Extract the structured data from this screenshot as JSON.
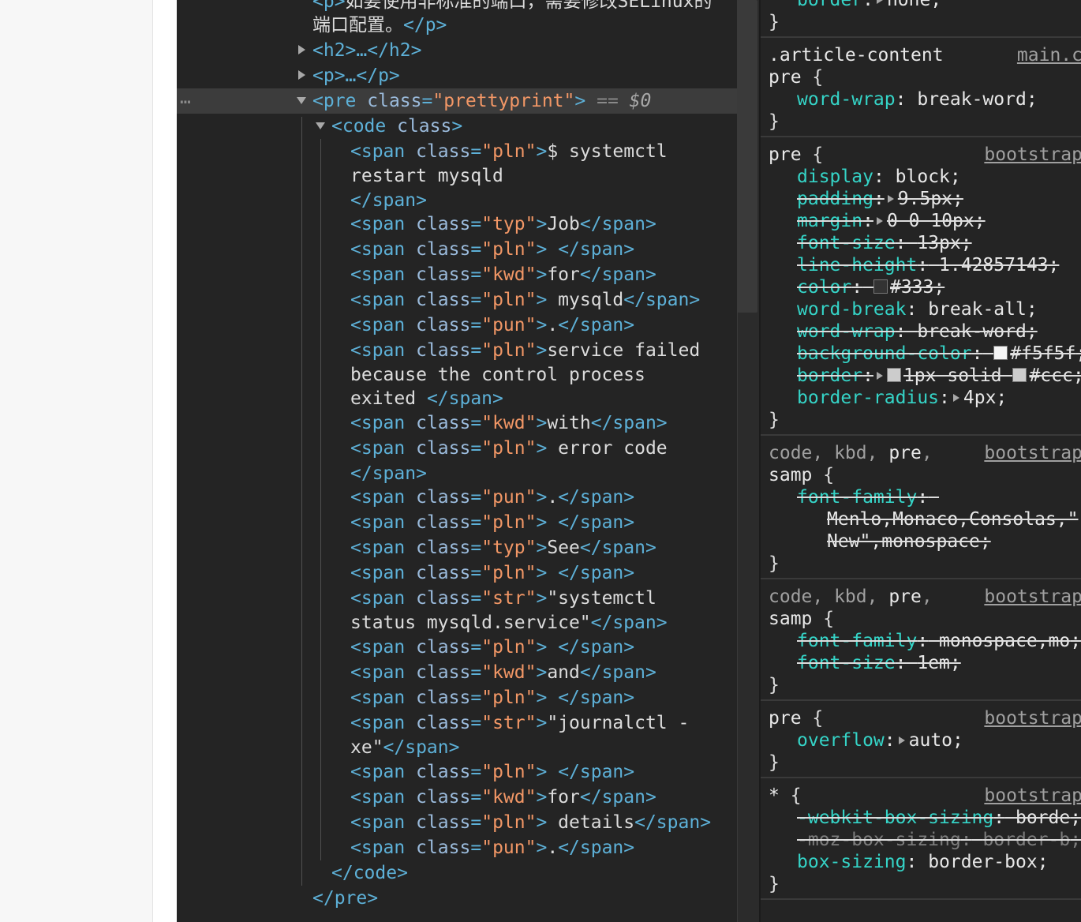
{
  "elements": {
    "p_text_1": "如要使用非标准的端口，需要修改SELinux的",
    "p_text_2": "端口配置。",
    "h2_collapsed": "<h2>…</h2>",
    "p_collapsed": "<p>…</p>",
    "pre_open": "<pre",
    "pre_attr": "class",
    "pre_value": "\"prettyprint\"",
    "pre_close": ">",
    "eq_marker": "== ",
    "dollar_zero": "$0",
    "ellipsis": "…",
    "code_open": "<code",
    "code_attr": "class",
    "code_close": ">",
    "spans": [
      {
        "cls": "\"pln\"",
        "text": "$ systemctl",
        "more": [
          "restart mysqld"
        ],
        "close_line": true
      },
      {
        "cls": "\"typ\"",
        "text": "Job"
      },
      {
        "cls": "\"pln\"",
        "text": " "
      },
      {
        "cls": "\"kwd\"",
        "text": "for"
      },
      {
        "cls": "\"pln\"",
        "text": " mysqld"
      },
      {
        "cls": "\"pun\"",
        "text": "."
      },
      {
        "cls": "\"pln\"",
        "text": "service failed",
        "more": [
          "because the control process",
          "exited "
        ]
      },
      {
        "cls": "\"kwd\"",
        "text": "with"
      },
      {
        "cls": "\"pln\"",
        "text": " error code",
        "close_line": true
      },
      {
        "cls": "\"pun\"",
        "text": "."
      },
      {
        "cls": "\"pln\"",
        "text": " "
      },
      {
        "cls": "\"typ\"",
        "text": "See"
      },
      {
        "cls": "\"pln\"",
        "text": " "
      },
      {
        "cls": "\"str\"",
        "text": "\"systemctl",
        "more": [
          "status mysqld.service\""
        ]
      },
      {
        "cls": "\"pln\"",
        "text": " "
      },
      {
        "cls": "\"kwd\"",
        "text": "and"
      },
      {
        "cls": "\"pln\"",
        "text": " "
      },
      {
        "cls": "\"str\"",
        "text": "\"journalctl -",
        "more": [
          "xe\""
        ]
      },
      {
        "cls": "\"pln\"",
        "text": " "
      },
      {
        "cls": "\"kwd\"",
        "text": "for"
      },
      {
        "cls": "\"pln\"",
        "text": " details"
      },
      {
        "cls": "\"pun\"",
        "text": "."
      }
    ],
    "span_open": "<span",
    "span_attr": "class",
    "span_close": "</span>",
    "code_end": "</code>",
    "pre_end": "</pre>"
  },
  "styles": {
    "rules": [
      {
        "selector_lines": [],
        "props": [
          {
            "name": "border",
            "value": "none",
            "arrow": true
          }
        ],
        "partial_top": true
      },
      {
        "selector_lines": [
          ".article-content",
          "pre "
        ],
        "source": "main.c",
        "props": [
          {
            "name": "word-wrap",
            "value": "break-word"
          }
        ]
      },
      {
        "selector_lines": [
          "pre "
        ],
        "source": "bootstrap",
        "props": [
          {
            "name": "display",
            "value": "block"
          },
          {
            "name": "padding",
            "value": "9.5px",
            "arrow": true,
            "struck": true
          },
          {
            "name": "margin",
            "value": "0 0 10px",
            "arrow": true,
            "struck": true
          },
          {
            "name": "font-size",
            "value": "13px",
            "struck": true
          },
          {
            "name": "line-height",
            "value": "1.42857143",
            "struck": true
          },
          {
            "name": "color",
            "value": "#333",
            "swatch": "#333333",
            "struck": true
          },
          {
            "name": "word-break",
            "value": "break-all"
          },
          {
            "name": "word-wrap",
            "value": "break-word",
            "struck": true
          },
          {
            "name": "background-color",
            "value": "#f5f5f",
            "swatch": "#f5f5f5",
            "struck": true
          },
          {
            "name": "border",
            "value": "1px solid ",
            "swatch": "#cccccc",
            "value2": "#ccc;",
            "arrow": true,
            "struck": true
          },
          {
            "name": "border-radius",
            "value": "4px",
            "arrow": true
          }
        ]
      },
      {
        "selector_lines": [
          "code, kbd, pre,",
          "samp "
        ],
        "source": "bootstrap",
        "props": [
          {
            "name": "font-family",
            "value": "",
            "struck": true,
            "cont": [
              "Menlo,Monaco,Consolas,\"",
              "New\",monospace;"
            ]
          }
        ]
      },
      {
        "selector_lines": [
          "code, kbd, pre,",
          "samp "
        ],
        "source": "bootstrap",
        "props": [
          {
            "name": "font-family",
            "value": "monospace,mo",
            "struck": true
          },
          {
            "name": "font-size",
            "value": "1em",
            "struck": true
          }
        ]
      },
      {
        "selector_lines": [
          "pre "
        ],
        "source": "bootstrap",
        "props": [
          {
            "name": "overflow",
            "value": "auto",
            "arrow": true
          }
        ]
      },
      {
        "selector_lines": [
          "* "
        ],
        "source": "bootstrap",
        "props": [
          {
            "name": "-webkit-box-sizing",
            "value": "borde",
            "struck": true
          },
          {
            "name": "-moz-box-sizing",
            "value": "border-b",
            "struck": true,
            "faded": true
          },
          {
            "name": "box-sizing",
            "value": "border-box"
          }
        ]
      }
    ]
  }
}
